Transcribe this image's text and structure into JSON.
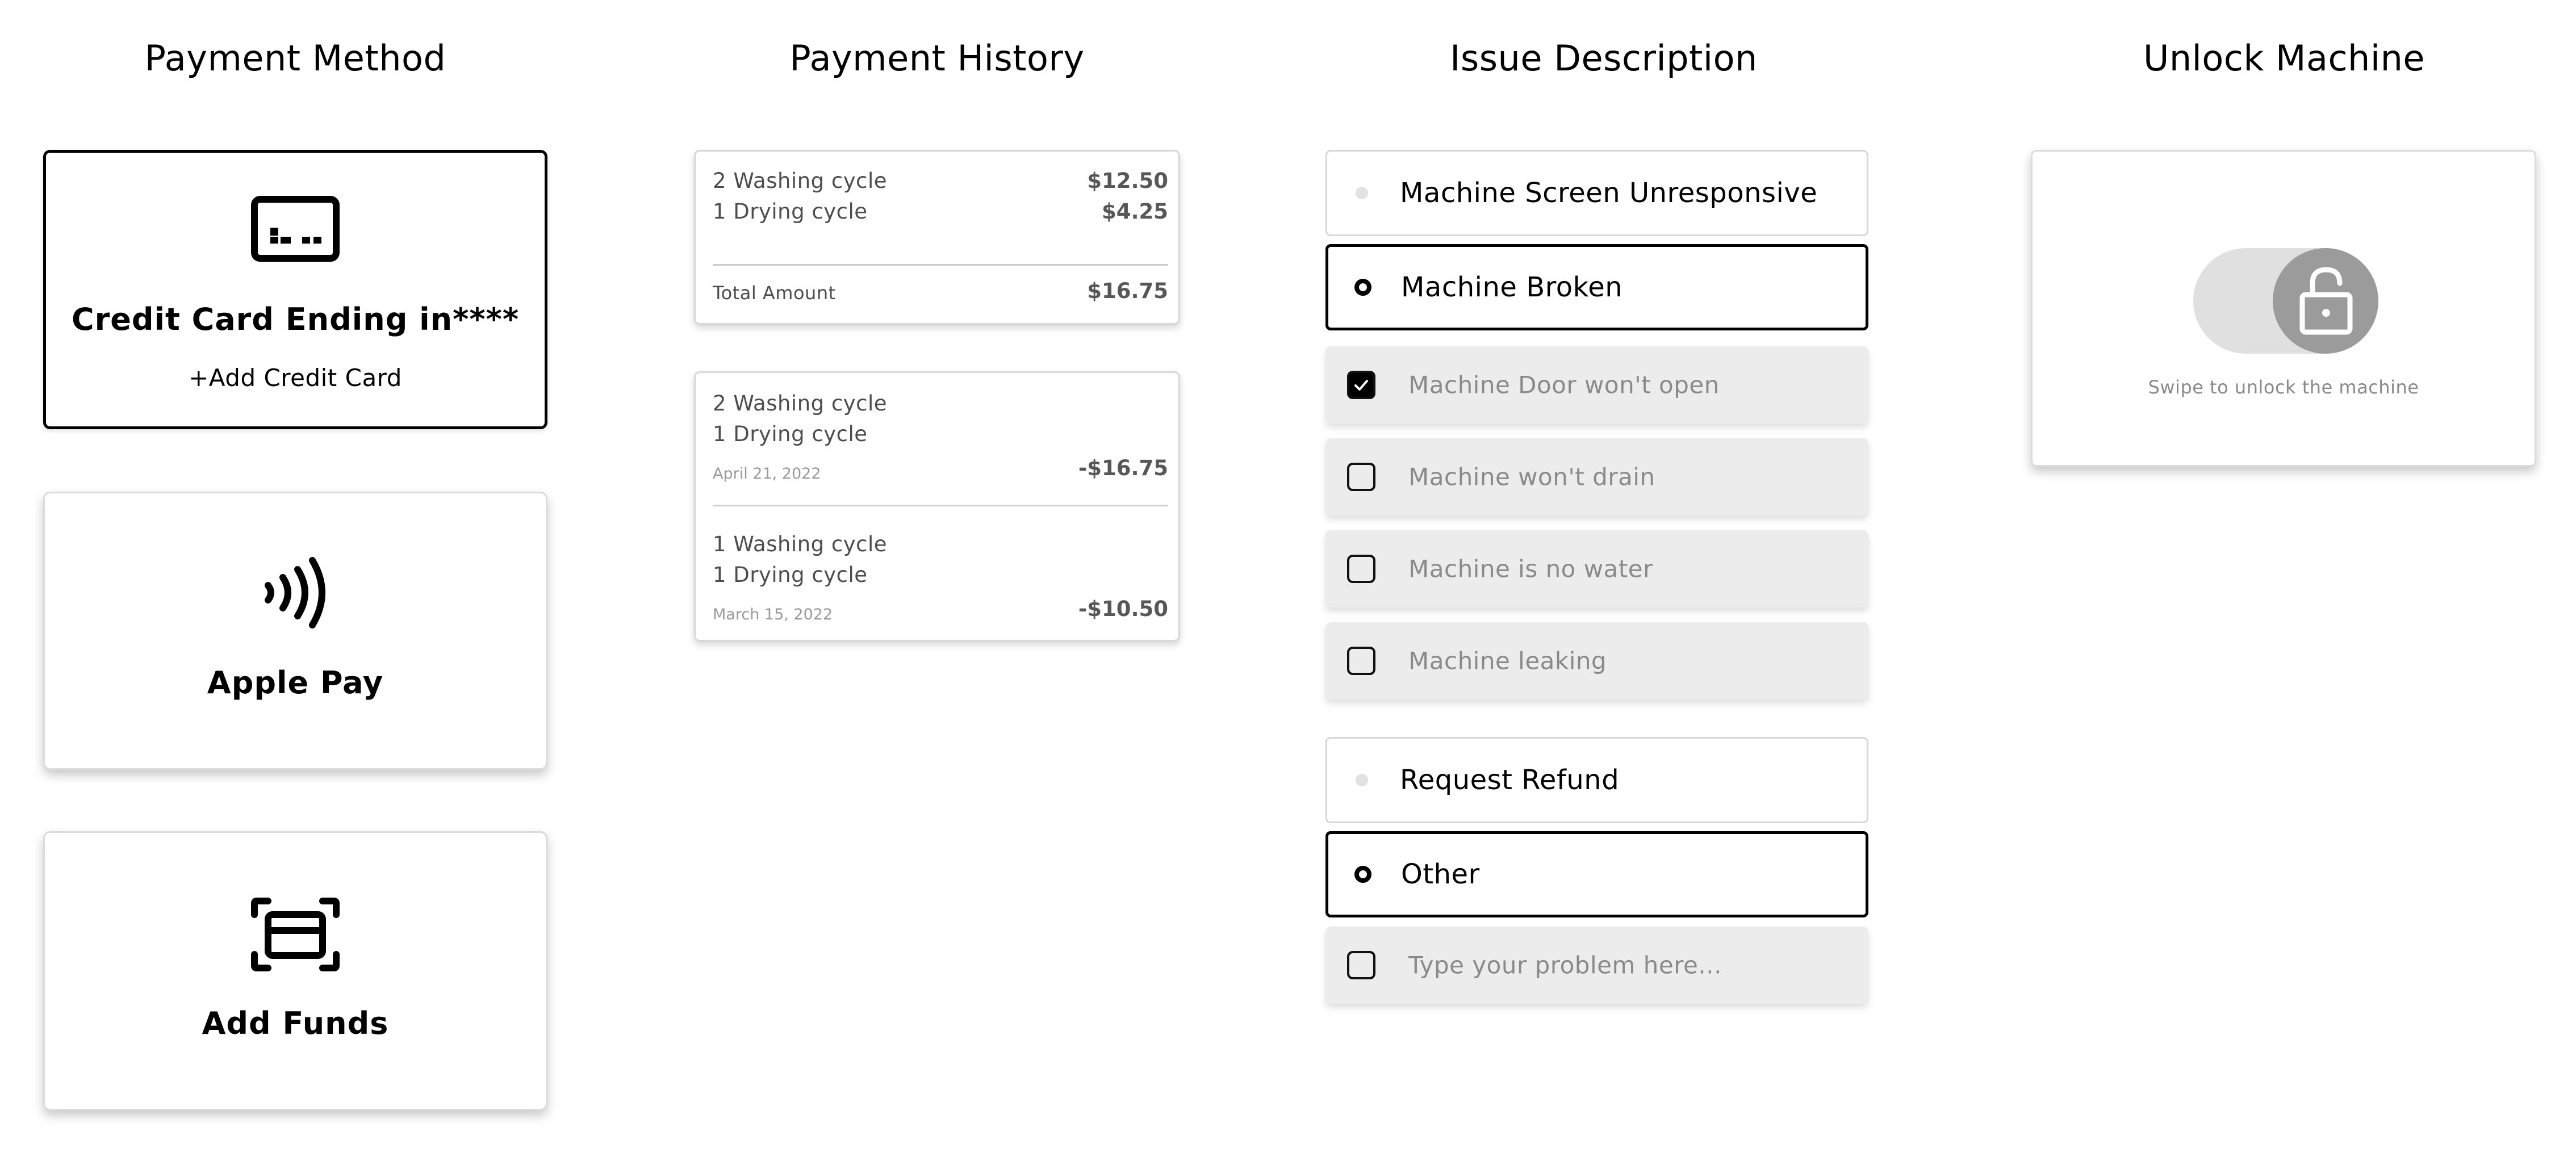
{
  "columns": {
    "payment_method": "Payment Method",
    "payment_history": "Payment History",
    "issue_description": "Issue Description",
    "unlock_machine": "Unlock Machine"
  },
  "payment_methods": {
    "credit_card": {
      "title": "Credit Card Ending in****",
      "sub": "+Add Credit Card",
      "icon": "credit-card-icon",
      "selected": true
    },
    "apple_pay": {
      "title": "Apple Pay",
      "icon": "contactless-icon"
    },
    "add_funds": {
      "title": "Add Funds",
      "icon": "scan-card-icon"
    }
  },
  "history": {
    "summary": {
      "items": [
        {
          "label": "2 Washing cycle",
          "amount": "$12.50"
        },
        {
          "label": "1 Drying cycle",
          "amount": "$4.25"
        }
      ],
      "total_label": "Total Amount",
      "total_amount": "$16.75"
    },
    "transactions": [
      {
        "line1": "2 Washing cycle",
        "line2": "1 Drying cycle",
        "date": "April 21, 2022",
        "amount": "-$16.75"
      },
      {
        "line1": "1 Washing cycle",
        "line2": "1 Drying cycle",
        "date": "March 15, 2022",
        "amount": "-$10.50"
      }
    ]
  },
  "issues": {
    "options": [
      {
        "label": "Machine Screen Unresponsive",
        "type": "radio",
        "selected": false
      },
      {
        "label": "Machine Broken",
        "type": "radio",
        "selected": true
      },
      {
        "label": "Machine Door won't open",
        "type": "checkbox",
        "checked": true
      },
      {
        "label": "Machine won't drain",
        "type": "checkbox",
        "checked": false
      },
      {
        "label": "Machine is no water",
        "type": "checkbox",
        "checked": false
      },
      {
        "label": "Machine leaking",
        "type": "checkbox",
        "checked": false
      },
      {
        "label": "Request Refund",
        "type": "radio",
        "selected": false
      },
      {
        "label": "Other",
        "type": "radio",
        "selected": true
      }
    ],
    "other_placeholder": "Type your problem here..."
  },
  "unlock": {
    "hint": "Swipe to unlock the machine",
    "icon": "unlock-icon"
  },
  "colors": {
    "accent": "#000000",
    "muted_text": "#8a8a8a",
    "option_bg": "#ececec",
    "slider_track": "#e0e0e0",
    "slider_knob": "#9b9b9b"
  }
}
